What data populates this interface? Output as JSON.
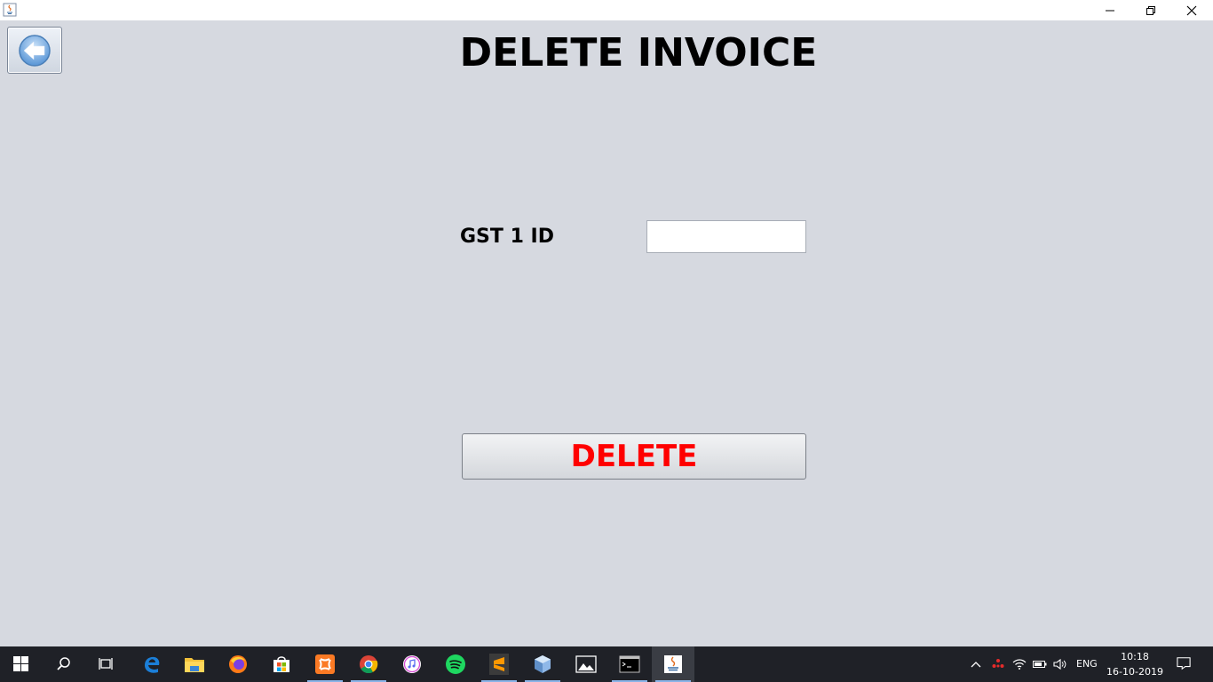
{
  "window": {
    "controls": [
      "minimize",
      "restore",
      "close"
    ]
  },
  "page": {
    "title": "DELETE INVOICE",
    "back_button_icon": "back-arrow-icon"
  },
  "form": {
    "gst_label": "GST 1 ID",
    "gst_value": "",
    "delete_label": "DELETE",
    "delete_color": "#ff0000"
  },
  "taskbar": {
    "apps": [
      "start",
      "search",
      "task-view",
      "edge",
      "file-explorer",
      "firefox",
      "store",
      "xampp",
      "chrome",
      "itunes",
      "spotify",
      "sublime-text",
      "virtualbox",
      "photos",
      "terminal",
      "java"
    ],
    "tray": {
      "language": "ENG",
      "time": "10:18",
      "date": "16-10-2019"
    }
  },
  "colors": {
    "background": "#d6d9e0",
    "taskbar": "#1f2127"
  }
}
